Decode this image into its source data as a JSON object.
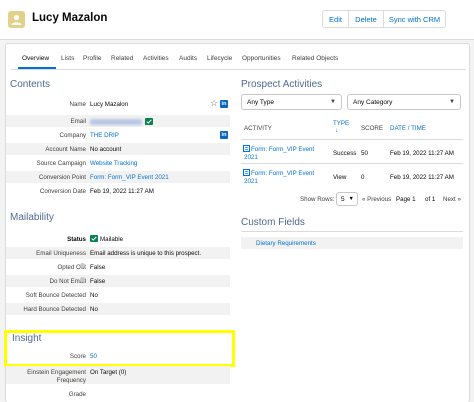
{
  "header": {
    "title": "Lucy Mazalon",
    "buttons": {
      "edit": "Edit",
      "delete": "Delete",
      "sync": "Sync with CRM"
    }
  },
  "tabs": [
    "Overview",
    "Lists",
    "Profile",
    "Related",
    "Activities",
    "Audits",
    "Lifecycle",
    "Opportunities",
    "Related Objects"
  ],
  "contents": {
    "title": "Contents",
    "fields": [
      {
        "label": "Name",
        "value": "Lucy Mazalon"
      },
      {
        "label": "Email",
        "value": ""
      },
      {
        "label": "Company",
        "value": "THE DRIP"
      },
      {
        "label": "Account Name",
        "value": "No account"
      },
      {
        "label": "Source Campaign",
        "value": "Website Tracking"
      },
      {
        "label": "Conversion Point",
        "value": "Form: Form_VIP Event 2021"
      },
      {
        "label": "Conversion Date",
        "value": "Feb 19, 2022 11:27 AM"
      }
    ]
  },
  "mailability": {
    "title": "Mailability",
    "fields": [
      {
        "label": "Status",
        "value": "Mailable"
      },
      {
        "label": "Email Uniqueness",
        "value": "Email address is unique to this prospect."
      },
      {
        "label": "Opted Out",
        "value": "False"
      },
      {
        "label": "Do Not Email",
        "value": "False"
      },
      {
        "label": "Soft Bounce Detected",
        "value": "No"
      },
      {
        "label": "Hard Bounce Detected",
        "value": "No"
      }
    ]
  },
  "insight": {
    "title": "Insight",
    "score_label": "Score",
    "score_value": "50",
    "engagement_label_1": "Einstein Engagement",
    "engagement_label_2": "Frequency",
    "engagement_value": "On Target (0)",
    "grade_label": "Grade"
  },
  "prospect_activities": {
    "title": "Prospect Activities",
    "type_filter": "Any Type",
    "category_filter": "Any Category",
    "columns": {
      "activity": "ACTIVITY",
      "type": "TYPE",
      "score": "SCORE",
      "date": "DATE / TIME"
    },
    "rows": [
      {
        "activity_1": "Form: Form_VIP Event",
        "activity_2": "2021",
        "type": "Success",
        "score": "50",
        "date": "Feb 19, 2022 11:27 AM"
      },
      {
        "activity_1": "Form: Form_VIP Event",
        "activity_2": "2021",
        "type": "View",
        "score": "0",
        "date": "Feb 19, 2022 11:27 AM"
      }
    ],
    "pager": {
      "show_rows_label": "Show Rows:",
      "rows_value": "5",
      "previous": "« Previous",
      "page_label": "Page 1",
      "of_label": "of 1",
      "next": "Next »"
    }
  },
  "custom_fields": {
    "title": "Custom Fields",
    "item": "Dietary Requirements"
  },
  "colors": {
    "link": "#0070d2",
    "section_title": "#4f6a92",
    "highlight": "#ffff00",
    "mailable_check": "#04844b"
  }
}
